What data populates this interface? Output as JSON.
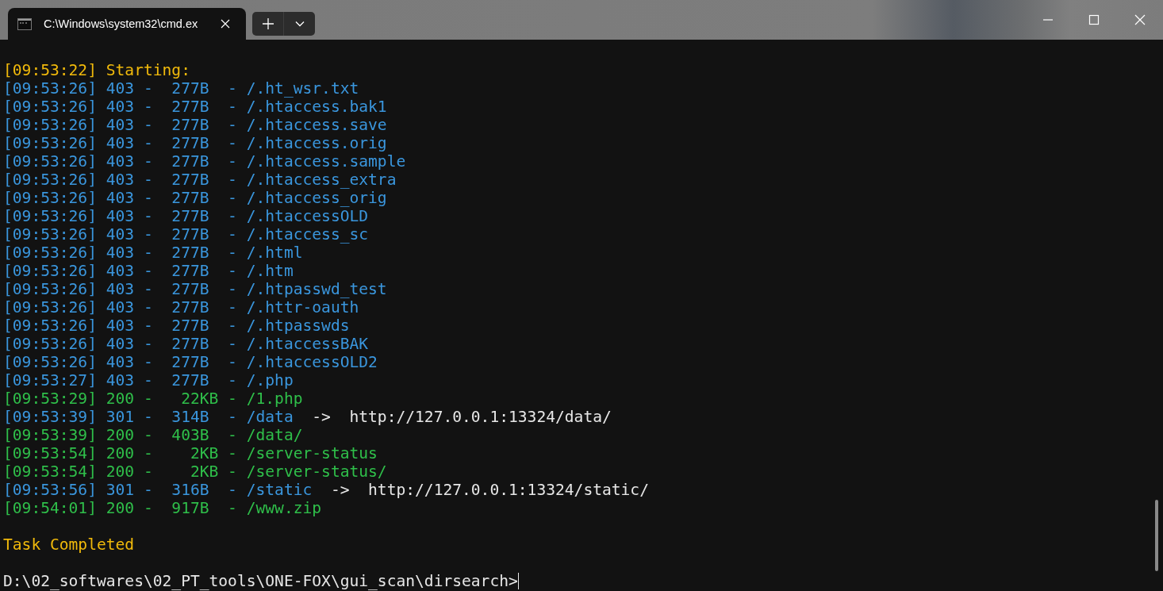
{
  "window": {
    "tabs": [
      {
        "title": "C:\\Windows\\system32\\cmd.ex",
        "selected": true
      }
    ]
  },
  "terminal": {
    "lines": [
      {
        "text": "[09:53:22] Starting:",
        "color": "#f0b90b"
      },
      {
        "text": "[09:53:26] 403 -  277B  - /.ht_wsr.txt",
        "color": "#3a96dd"
      },
      {
        "text": "[09:53:26] 403 -  277B  - /.htaccess.bak1",
        "color": "#3a96dd"
      },
      {
        "text": "[09:53:26] 403 -  277B  - /.htaccess.save",
        "color": "#3a96dd"
      },
      {
        "text": "[09:53:26] 403 -  277B  - /.htaccess.orig",
        "color": "#3a96dd"
      },
      {
        "text": "[09:53:26] 403 -  277B  - /.htaccess.sample",
        "color": "#3a96dd"
      },
      {
        "text": "[09:53:26] 403 -  277B  - /.htaccess_extra",
        "color": "#3a96dd"
      },
      {
        "text": "[09:53:26] 403 -  277B  - /.htaccess_orig",
        "color": "#3a96dd"
      },
      {
        "text": "[09:53:26] 403 -  277B  - /.htaccessOLD",
        "color": "#3a96dd"
      },
      {
        "text": "[09:53:26] 403 -  277B  - /.htaccess_sc",
        "color": "#3a96dd"
      },
      {
        "text": "[09:53:26] 403 -  277B  - /.html",
        "color": "#3a96dd"
      },
      {
        "text": "[09:53:26] 403 -  277B  - /.htm",
        "color": "#3a96dd"
      },
      {
        "text": "[09:53:26] 403 -  277B  - /.htpasswd_test",
        "color": "#3a96dd"
      },
      {
        "text": "[09:53:26] 403 -  277B  - /.httr-oauth",
        "color": "#3a96dd"
      },
      {
        "text": "[09:53:26] 403 -  277B  - /.htpasswds",
        "color": "#3a96dd"
      },
      {
        "text": "[09:53:26] 403 -  277B  - /.htaccessBAK",
        "color": "#3a96dd"
      },
      {
        "text": "[09:53:26] 403 -  277B  - /.htaccessOLD2",
        "color": "#3a96dd"
      },
      {
        "text": "[09:53:27] 403 -  277B  - /.php",
        "color": "#3a96dd"
      },
      {
        "text": "[09:53:29] 200 -   22KB - /1.php",
        "color": "#2fbf4a"
      },
      {
        "text": "[09:53:39] 301 -  314B  - /data",
        "color": "#3a96dd",
        "redirect": "->  http://127.0.0.1:13324/data/"
      },
      {
        "text": "[09:53:39] 200 -  403B  - /data/",
        "color": "#2fbf4a"
      },
      {
        "text": "[09:53:54] 200 -    2KB - /server-status",
        "color": "#2fbf4a"
      },
      {
        "text": "[09:53:54] 200 -    2KB - /server-status/",
        "color": "#2fbf4a"
      },
      {
        "text": "[09:53:56] 301 -  316B  - /static",
        "color": "#3a96dd",
        "redirect": "->  http://127.0.0.1:13324/static/"
      },
      {
        "text": "[09:54:01] 200 -  917B  - /www.zip",
        "color": "#2fbf4a"
      }
    ],
    "message": "Task Completed",
    "prompt": "D:\\02_softwares\\02_PT_tools\\ONE-FOX\\gui_scan\\dirsearch>"
  }
}
